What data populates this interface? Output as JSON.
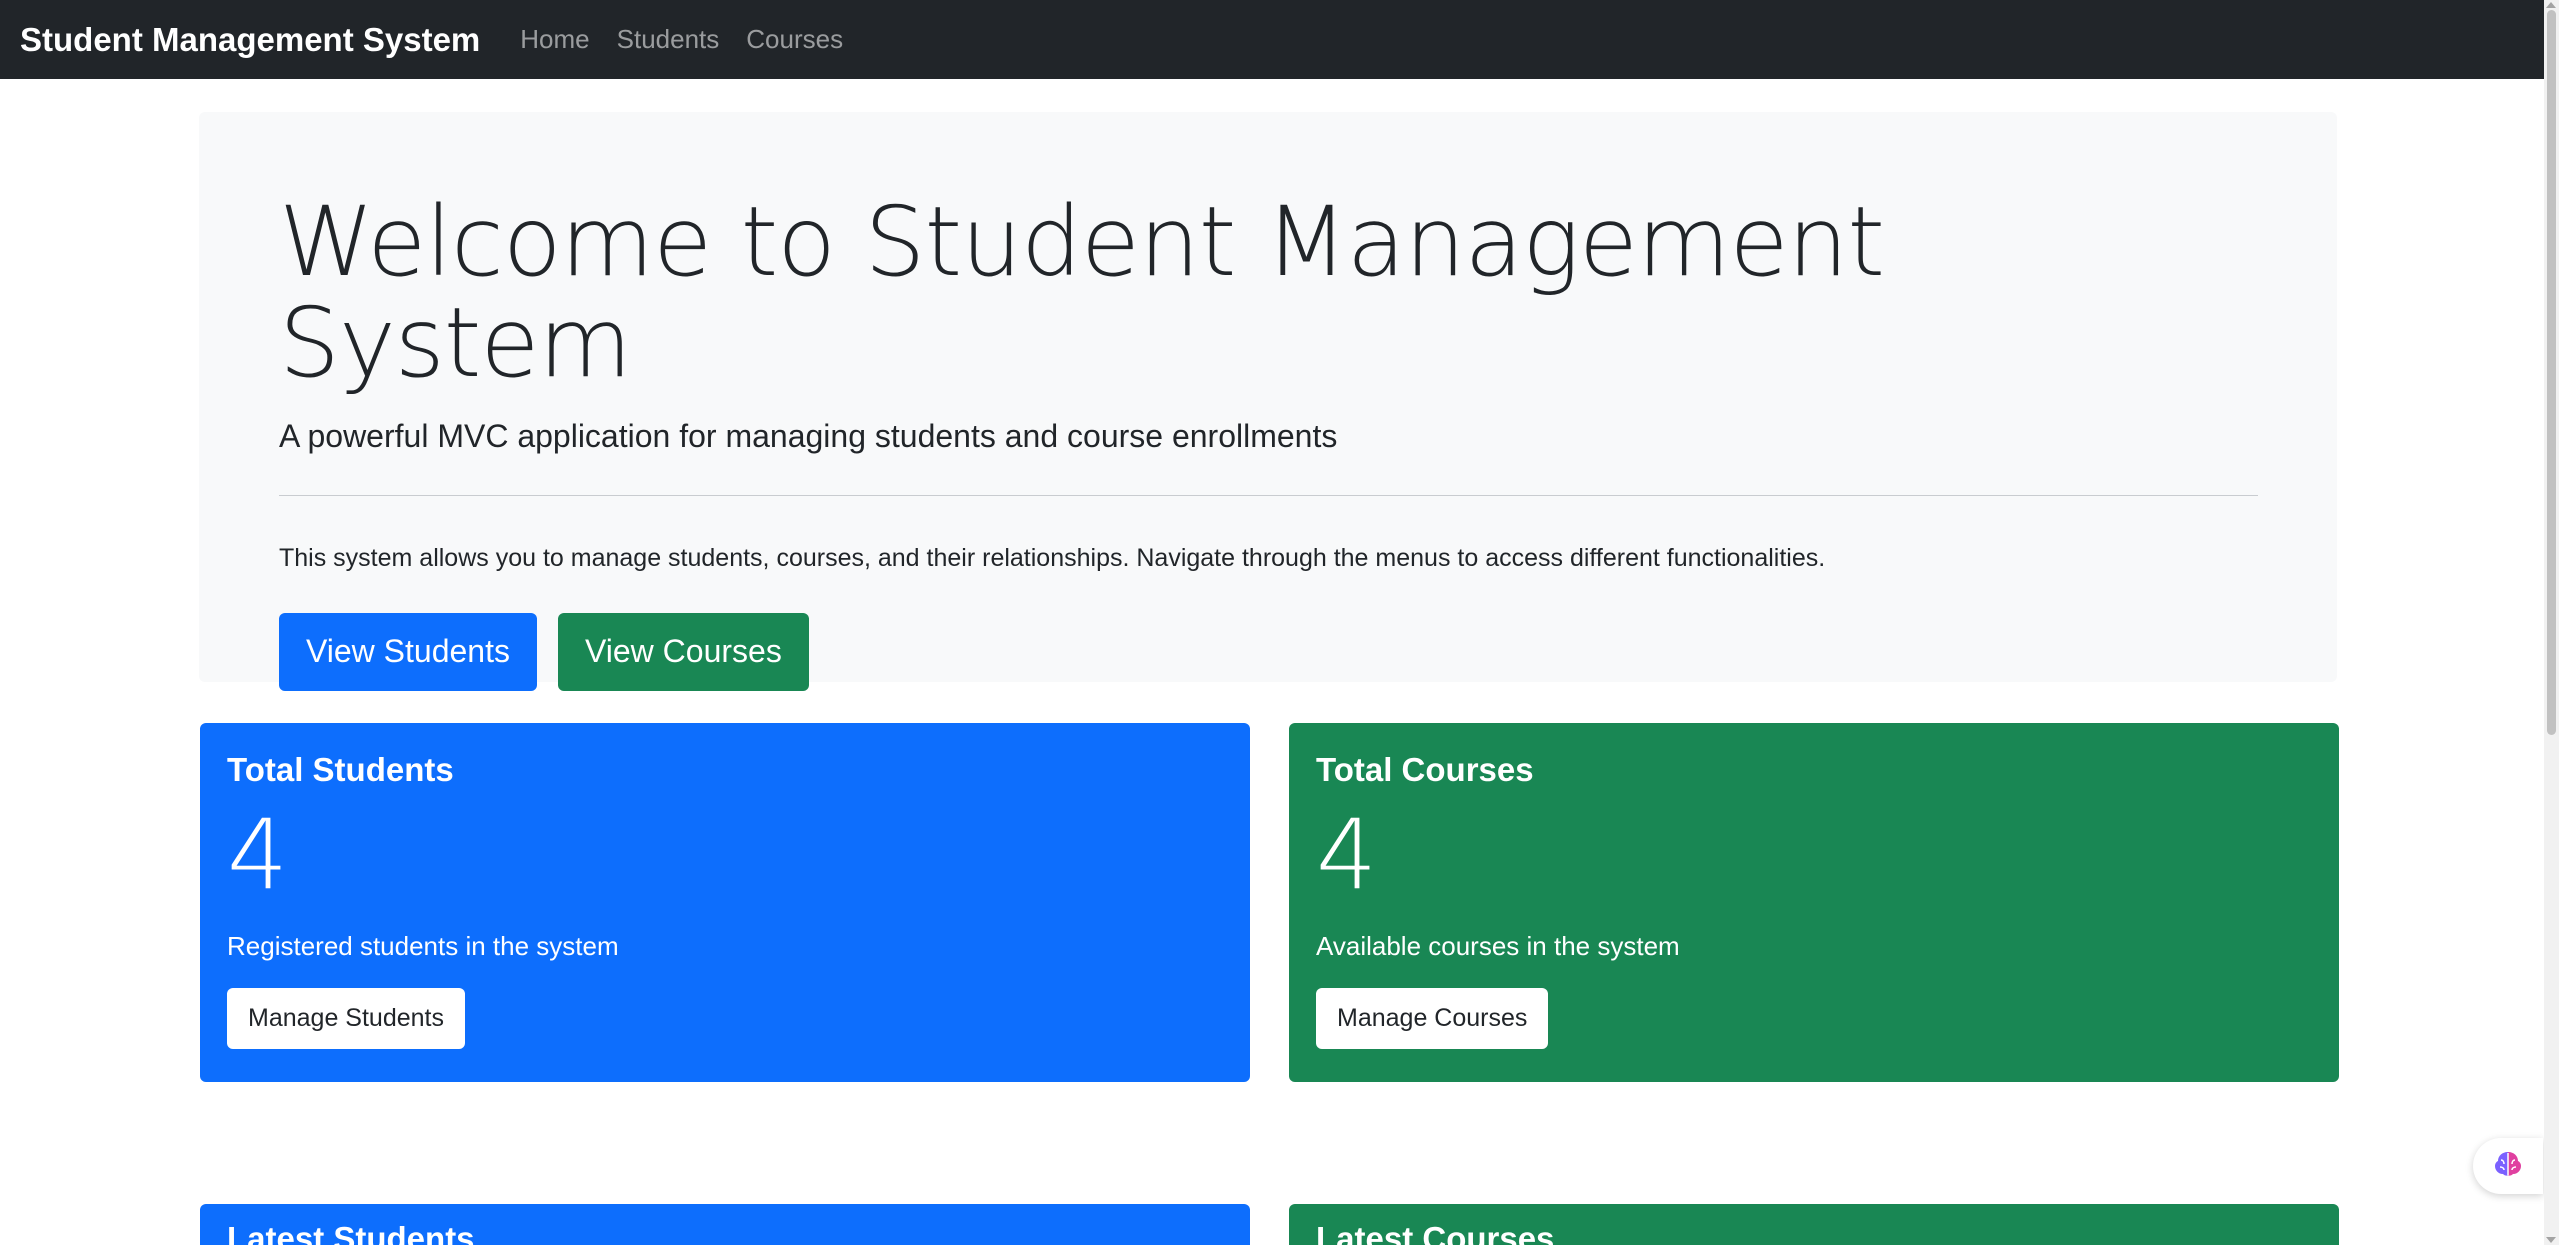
{
  "navbar": {
    "brand": "Student Management System",
    "links": [
      "Home",
      "Students",
      "Courses"
    ]
  },
  "hero": {
    "title": "Welcome to Student Management System",
    "lead": "A powerful MVC application for managing students and course enrollments",
    "text": "This system allows you to manage students, courses, and their relationships. Navigate through the menus to access different functionalities.",
    "btn_students": "View Students",
    "btn_courses": "View Courses"
  },
  "stats": {
    "students": {
      "title": "Total Students",
      "count": "4",
      "text": "Registered students in the system",
      "button": "Manage Students"
    },
    "courses": {
      "title": "Total Courses",
      "count": "4",
      "text": "Available courses in the system",
      "button": "Manage Courses"
    }
  },
  "latest": {
    "students_title": "Latest Students",
    "courses_title": "Latest Courses"
  },
  "colors": {
    "primary": "#0d6efd",
    "success": "#198754",
    "navbar": "#212529",
    "hero_bg": "#f8f9fa"
  },
  "icons": {
    "widget": "brain-icon"
  }
}
